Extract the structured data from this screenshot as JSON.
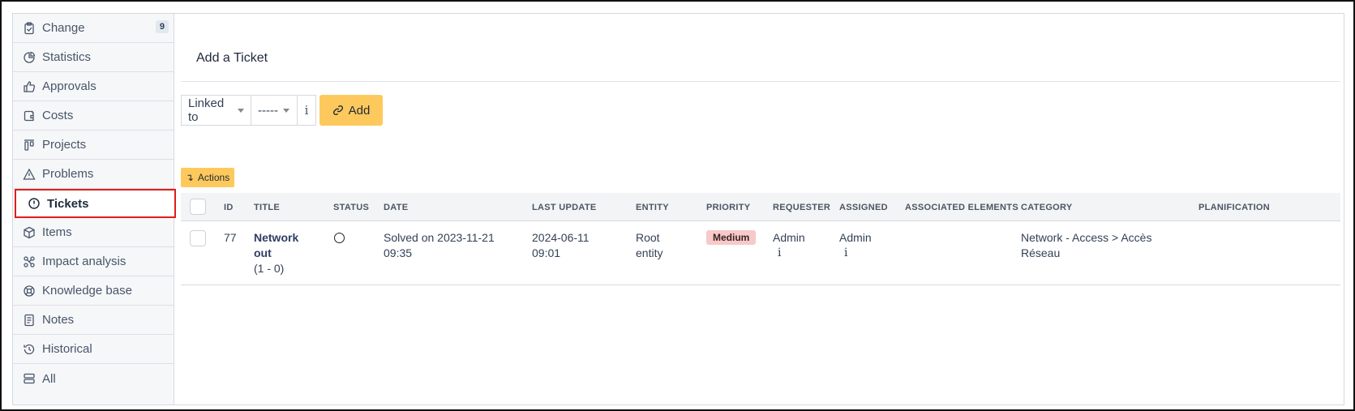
{
  "sidebar": {
    "items": [
      {
        "label": "Change",
        "icon": "clipboard-check-icon",
        "badge": "9"
      },
      {
        "label": "Statistics",
        "icon": "pie-chart-icon"
      },
      {
        "label": "Approvals",
        "icon": "thumbs-up-icon"
      },
      {
        "label": "Costs",
        "icon": "wallet-icon"
      },
      {
        "label": "Projects",
        "icon": "columns-icon"
      },
      {
        "label": "Problems",
        "icon": "warning-triangle-icon"
      },
      {
        "label": "Tickets",
        "icon": "alert-circle-icon",
        "active": true
      },
      {
        "label": "Items",
        "icon": "package-icon"
      },
      {
        "label": "Impact analysis",
        "icon": "share-nodes-icon"
      },
      {
        "label": "Knowledge base",
        "icon": "lifebuoy-icon"
      },
      {
        "label": "Notes",
        "icon": "notes-icon"
      },
      {
        "label": "Historical",
        "icon": "history-icon"
      },
      {
        "label": "All",
        "icon": "stack-icon"
      }
    ]
  },
  "main": {
    "add_title": "Add a Ticket",
    "link_select": "Linked to",
    "ticket_select": "-----",
    "info_glyph": "i",
    "add_button": "Add",
    "actions_button": "Actions",
    "columns": [
      "ID",
      "TITLE",
      "STATUS",
      "DATE",
      "LAST UPDATE",
      "ENTITY",
      "PRIORITY",
      "REQUESTER",
      "ASSIGNED",
      "ASSOCIATED ELEMENTS",
      "CATEGORY",
      "PLANIFICATION"
    ],
    "rows": [
      {
        "id": "77",
        "title_line1": "Network",
        "title_line2": "out",
        "title_sub": "(1 - 0)",
        "date_line1": "Solved on 2023-11-21",
        "date_line2": "09:35",
        "update_line1": "2024-06-11",
        "update_line2": "09:01",
        "entity_line1": "Root",
        "entity_line2": "entity",
        "priority": "Medium",
        "requester": "Admin",
        "assigned": "Admin",
        "associated": "",
        "category_line1": "Network - Access > Accès",
        "category_line2": "Réseau",
        "planification": ""
      }
    ]
  },
  "colors": {
    "accent_button": "#fec95c",
    "priority_medium": "#f8c9c9",
    "active_border": "#e11d1d"
  }
}
